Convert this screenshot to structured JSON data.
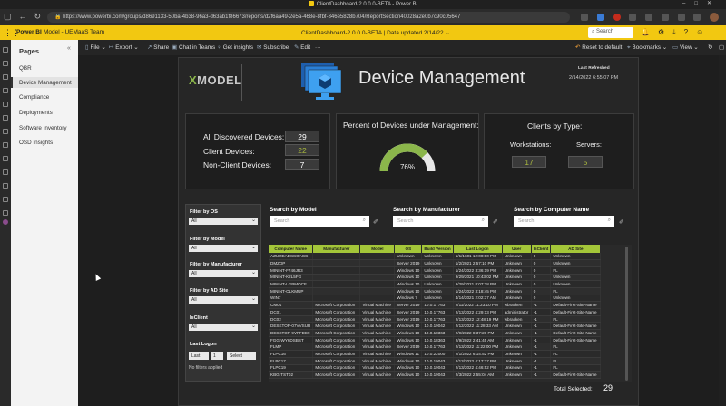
{
  "browser": {
    "window_title": "ClientDashboard-2.0.0.0-BETA - Power BI",
    "url": "https://www.powerbi.com/groups/d8691133-50ba-4b38-96a3-d63ab1f86673/reports/d2f6aa49-2e5a-468e-8fbf-346e5828b704/ReportSection40028a2e0b7c90c05647"
  },
  "pbi_header": {
    "app": "Power BI",
    "workspace": "Model - UEMaaS Team",
    "report_title": "ClientDashboard-2.0.0.0-BETA",
    "updated": "Data updated 2/14/22",
    "search_placeholder": "Search"
  },
  "toolbar": {
    "file": "File",
    "export": "Export",
    "share": "Share",
    "chat": "Chat in Teams",
    "insights": "Get insights",
    "subscribe": "Subscribe",
    "edit": "Edit",
    "more": "···",
    "reset": "Reset to default",
    "bookmarks": "Bookmarks",
    "view": "View"
  },
  "pages_panel": {
    "header": "Pages",
    "items": [
      "QBR",
      "Device Management",
      "Compliance",
      "Deployments",
      "Software Inventory",
      "OSD Insights"
    ],
    "active_index": 1
  },
  "report": {
    "logo_text": "MODEL",
    "title": "Device Management",
    "last_refreshed_label": "Last Refreshed",
    "last_refreshed_value": "2/14/2022 6:55:07 PM",
    "counts": {
      "all_label": "All Discovered Devices:",
      "all_value": "29",
      "client_label": "Client Devices:",
      "client_value": "22",
      "nonclient_label": "Non-Client Devices:",
      "nonclient_value": "7"
    },
    "gauge": {
      "title": "Percent of Devices under Management:",
      "percent": 76,
      "label": "76%",
      "fill_color": "#8bb64b",
      "track_color": "#e8e8e8"
    },
    "clients_by_type": {
      "title": "Clients by Type:",
      "workstations_label": "Workstations:",
      "workstations_value": "17",
      "servers_label": "Servers:",
      "servers_value": "5"
    },
    "filters": [
      {
        "label": "Filter by OS",
        "value": "All"
      },
      {
        "label": "Filter by Model",
        "value": "All"
      },
      {
        "label": "Filter by Manufacturer",
        "value": "All"
      },
      {
        "label": "Filter by AD Site",
        "value": "All"
      },
      {
        "label": "IsClient",
        "value": "All"
      }
    ],
    "last_logon": {
      "label": "Last Logon",
      "mode": "Last",
      "num": "1",
      "unit": "Select",
      "note": "No filters applied"
    },
    "search": {
      "model_label": "Search by Model",
      "manufacturer_label": "Search by Manufacturer",
      "computer_label": "Search by Computer Name",
      "placeholder": "Search"
    },
    "table": {
      "columns": [
        "Computer Name",
        "Manufacturer",
        "Model",
        "OS",
        "Build Version",
        "Last Logon",
        "User",
        "IsClient",
        "AD Site"
      ],
      "rows": [
        [
          "AZUREADSSOACC",
          "",
          "",
          "Unknown",
          "Unknown",
          "1/1/1601 12:00:00 PM",
          "Unknown",
          "0",
          "Unknown"
        ],
        [
          "DMZDP",
          "",
          "",
          "Server 2019",
          "Unknown",
          "1/2/2021 2:57:10 PM",
          "Unknown",
          "0",
          "Unknown"
        ],
        [
          "MININT-F746JR3",
          "",
          "",
          "Windows 10",
          "Unknown",
          "1/24/2022 3:36:19 PM",
          "Unknown",
          "0",
          "FL"
        ],
        [
          "MININT-K2L5FG",
          "",
          "",
          "Windows 10",
          "Unknown",
          "9/29/2021 10:43:02 PM",
          "Unknown",
          "0",
          "Unknown"
        ],
        [
          "MININT-LGBMOCF",
          "",
          "",
          "Windows 10",
          "Unknown",
          "9/29/2021 8:07:28 PM",
          "Unknown",
          "0",
          "Unknown"
        ],
        [
          "MININT-OLKMUP",
          "",
          "",
          "Windows 10",
          "Unknown",
          "1/24/2022 3:18:45 PM",
          "Unknown",
          "0",
          "FL"
        ],
        [
          "WIN7",
          "",
          "",
          "Windows 7",
          "Unknown",
          "4/14/2021 2:02:37 AM",
          "Unknown",
          "0",
          "Unknown"
        ],
        [
          "CM01",
          "Microsoft Corporation",
          "Virtual Machine",
          "Server 2019",
          "10.0.17763",
          "2/11/2022 11:23:10 PM",
          "wbracken",
          "-1",
          "Default-First-Site-Name"
        ],
        [
          "DC01",
          "Microsoft Corporation",
          "Virtual Machine",
          "Server 2019",
          "10.0.17763",
          "2/13/2022 4:29:13 PM",
          "administrator",
          "-1",
          "Default-First-Site-Name"
        ],
        [
          "DC02",
          "Microsoft Corporation",
          "Virtual Machine",
          "Server 2019",
          "10.0.17763",
          "2/13/2022 12:48:19 PM",
          "wbracken",
          "-1",
          "FL"
        ],
        [
          "DESKTOP-07VVSUR",
          "Microsoft Corporation",
          "Virtual Machine",
          "Windows 10",
          "10.0.19042",
          "2/12/2022 11:28:33 AM",
          "Unknown",
          "-1",
          "Default-First-Site-Name"
        ],
        [
          "DESKTOP-9VFFDE9",
          "Microsoft Corporation",
          "Virtual Machine",
          "Windows 10",
          "10.0.18363",
          "2/9/2022 8:37:28 PM",
          "Unknown",
          "-1",
          "Default-First-Site-Name"
        ],
        [
          "FGG-WY6DSBST",
          "Microsoft Corporation",
          "Virtual Machine",
          "Windows 10",
          "10.0.18363",
          "2/9/2022 2:41:45 AM",
          "Unknown",
          "-1",
          "Default-First-Site-Name"
        ],
        [
          "FLMP",
          "Microsoft Corporation",
          "Virtual Machine",
          "Server 2019",
          "10.0.17763",
          "2/13/2022 11:22:00 PM",
          "Unknown",
          "-1",
          "FL"
        ],
        [
          "FLPC16",
          "Microsoft Corporation",
          "Virtual Machine",
          "Windows 11",
          "10.0.22000",
          "2/1/2022 6:14:52 PM",
          "Unknown",
          "-1",
          "FL"
        ],
        [
          "FLPC17",
          "Microsoft Corporation",
          "Virtual Machine",
          "Windows 10",
          "10.0.19043",
          "2/13/2022 4:17:37 PM",
          "Unknown",
          "-1",
          "FL"
        ],
        [
          "FLPC19",
          "Microsoft Corporation",
          "Virtual Machine",
          "Windows 10",
          "10.0.19043",
          "2/13/2022 4:46:52 PM",
          "Unknown",
          "-1",
          "FL"
        ],
        [
          "KBG-TST02",
          "Microsoft Corporation",
          "Virtual Machine",
          "Windows 10",
          "10.0.19043",
          "2/3/2022 2:55:04 AM",
          "Unknown",
          "-1",
          "Default-First-Site-Name"
        ]
      ]
    },
    "total_selected_label": "Total Selected:",
    "total_selected_value": "29"
  }
}
